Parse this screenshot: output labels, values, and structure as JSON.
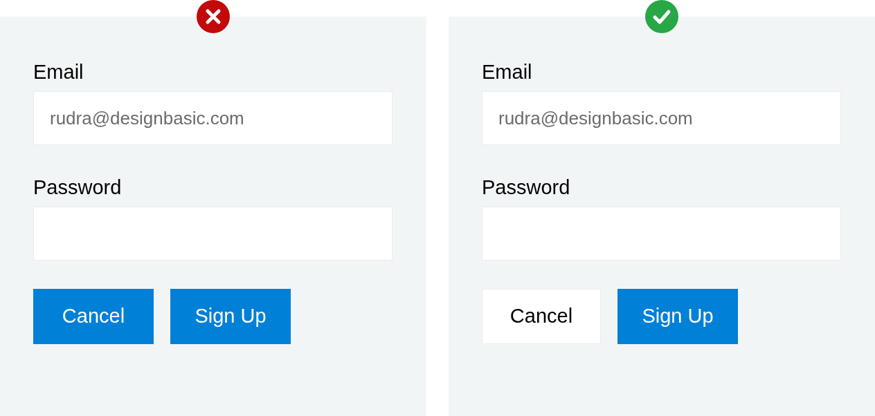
{
  "panels": [
    {
      "kind": "bad",
      "email_label": "Email",
      "email_placeholder": "rudra@designbasic.com",
      "password_label": "Password",
      "buttons": [
        {
          "label": "Cancel",
          "kind": "primary"
        },
        {
          "label": "Sign Up",
          "kind": "primary"
        }
      ]
    },
    {
      "kind": "good",
      "email_label": "Email",
      "email_placeholder": "rudra@designbasic.com",
      "password_label": "Password",
      "buttons": [
        {
          "label": "Cancel",
          "kind": "secondary"
        },
        {
          "label": "Sign Up",
          "kind": "primary"
        }
      ]
    }
  ]
}
